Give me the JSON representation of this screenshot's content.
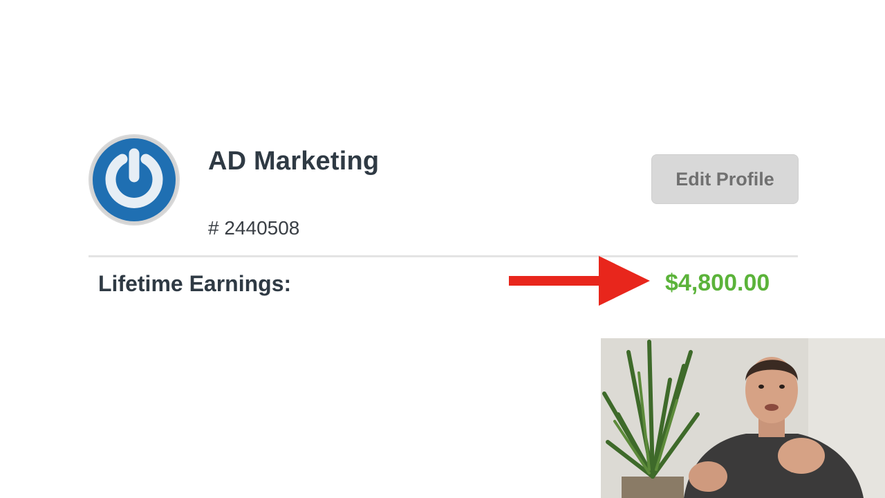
{
  "profile": {
    "name": "AD Marketing",
    "id_label": "# 2440508",
    "avatar_icon": "power-icon",
    "avatar_color": "#1f6fb2"
  },
  "actions": {
    "edit_profile_label": "Edit Profile"
  },
  "earnings": {
    "label": "Lifetime Earnings:",
    "value": "$4,800.00",
    "value_color": "#5bb33a"
  },
  "annotation": {
    "arrow_icon": "arrow-right-icon",
    "arrow_color": "#e8261c"
  },
  "overlay": {
    "type": "webcam-presenter"
  }
}
